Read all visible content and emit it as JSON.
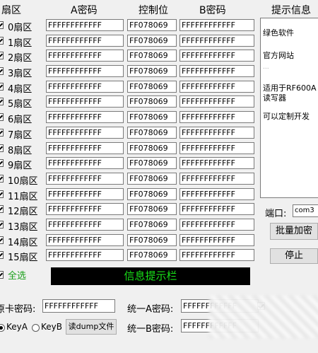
{
  "headers": {
    "sector": "扇区",
    "key_a": "A密码",
    "control": "控制位",
    "key_b": "B密码",
    "tips": "提示信息"
  },
  "sectors": [
    {
      "label": "0扇区",
      "key_a": "FFFFFFFFFFFF",
      "control": "FF078069",
      "key_b": "FFFFFFFFFFFF"
    },
    {
      "label": "1扇区",
      "key_a": "FFFFFFFFFFFF",
      "control": "FF078069",
      "key_b": "FFFFFFFFFFFF"
    },
    {
      "label": "2扇区",
      "key_a": "FFFFFFFFFFFF",
      "control": "FF078069",
      "key_b": "FFFFFFFFFFFF"
    },
    {
      "label": "3扇区",
      "key_a": "FFFFFFFFFFFF",
      "control": "FF078069",
      "key_b": "FFFFFFFFFFFF"
    },
    {
      "label": "4扇区",
      "key_a": "FFFFFFFFFFFF",
      "control": "FF078069",
      "key_b": "FFFFFFFFFFFF"
    },
    {
      "label": "5扇区",
      "key_a": "FFFFFFFFFFFF",
      "control": "FF078069",
      "key_b": "FFFFFFFFFFFF"
    },
    {
      "label": "6扇区",
      "key_a": "FFFFFFFFFFFF",
      "control": "FF078069",
      "key_b": "FFFFFFFFFFFF"
    },
    {
      "label": "7扇区",
      "key_a": "FFFFFFFFFFFF",
      "control": "FF078069",
      "key_b": "FFFFFFFFFFFF"
    },
    {
      "label": "8扇区",
      "key_a": "FFFFFFFFFFFF",
      "control": "FF078069",
      "key_b": "FFFFFFFFFFFF"
    },
    {
      "label": "9扇区",
      "key_a": "FFFFFFFFFFFF",
      "control": "FF078069",
      "key_b": "FFFFFFFFFFFF"
    },
    {
      "label": "10扇区",
      "key_a": "FFFFFFFFFFFF",
      "control": "FF078069",
      "key_b": "FFFFFFFFFFFF"
    },
    {
      "label": "11扇区",
      "key_a": "FFFFFFFFFFFF",
      "control": "FF078069",
      "key_b": "FFFFFFFFFFFF"
    },
    {
      "label": "12扇区",
      "key_a": "FFFFFFFFFFFF",
      "control": "FF078069",
      "key_b": "FFFFFFFFFFFF"
    },
    {
      "label": "13扇区",
      "key_a": "FFFFFFFFFFFF",
      "control": "FF078069",
      "key_b": "FFFFFFFFFFFF"
    },
    {
      "label": "14扇区",
      "key_a": "FFFFFFFFFFFF",
      "control": "FF078069",
      "key_b": "FFFFFFFFFFFF"
    },
    {
      "label": "15扇区",
      "key_a": "FFFFFFFFFFFF",
      "control": "FF078069",
      "key_b": "FFFFFFFFFFFF"
    }
  ],
  "tips": {
    "line1": "绿色软件",
    "line2": "官方网站",
    "line2_faded": "...",
    "line3": "适用于RF600A读写器",
    "line4": "可以定制开发"
  },
  "port": {
    "label": "端口:",
    "value": "com3"
  },
  "buttons": {
    "batch_encrypt": "批量加密",
    "stop": "停止",
    "read_dump": "读dump文件"
  },
  "select_all": "全选",
  "info_bar": "信息提示栏",
  "card_password": {
    "label": "原卡密码:",
    "value": "FFFFFFFFFFFF"
  },
  "unified_a": {
    "label": "统一A密码:",
    "value": "FFFFFFFFFFFF"
  },
  "unified_b": {
    "label": "统一B密码:",
    "value": "FFFFFFFFFFFF"
  },
  "key_radio": {
    "a": "KeyA",
    "b": "KeyB"
  }
}
